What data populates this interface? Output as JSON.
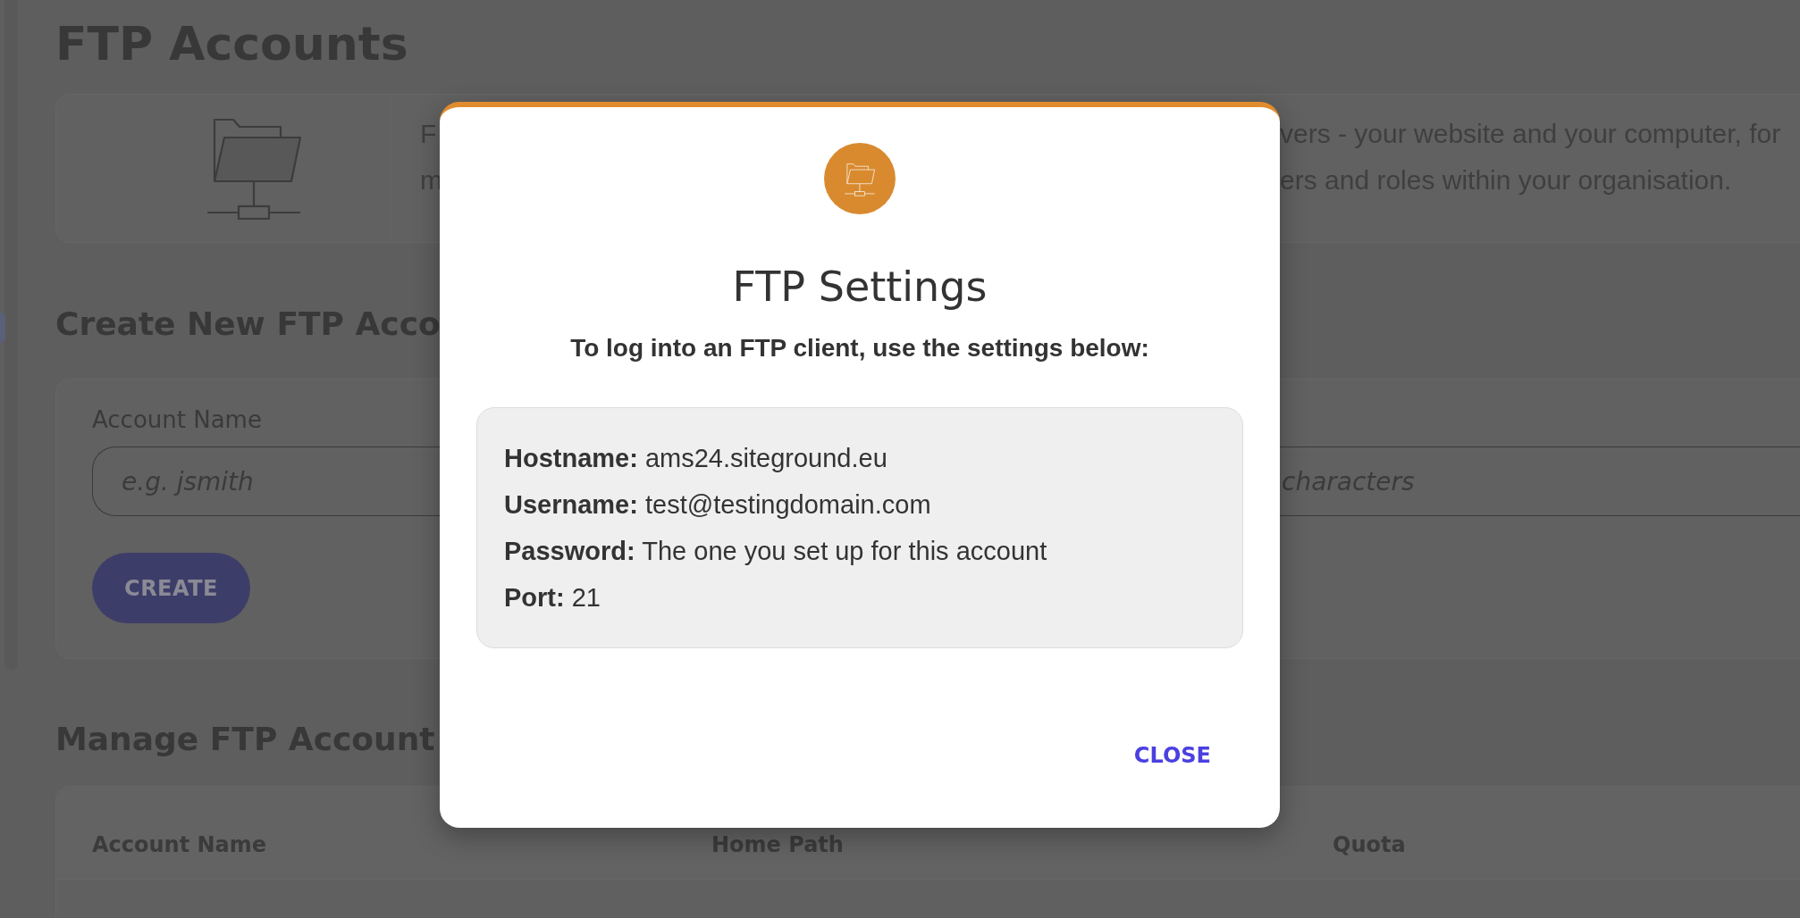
{
  "page": {
    "title": "FTP Accounts"
  },
  "info_card": {
    "lines": [
      {
        "start": "F",
        "end": "vers - your website and your computer, for"
      },
      {
        "start": "m",
        "end": "ers and roles within your organisation."
      }
    ]
  },
  "create_section": {
    "heading": "Create New FTP Acco",
    "fields": [
      {
        "label": "Account Name",
        "placeholder": "e.g. jsmith"
      },
      {
        "placeholder": "characters"
      }
    ],
    "button": "CREATE"
  },
  "manage_section": {
    "heading": "Manage FTP Account",
    "table": {
      "columns": [
        "Account Name",
        "Home Path",
        "Quota"
      ]
    }
  },
  "dialog": {
    "title": "FTP Settings",
    "subtitle": "To log into an FTP client, use the settings below:",
    "settings": [
      {
        "label": "Hostname:",
        "value": "ams24.siteground.eu"
      },
      {
        "label": "Username:",
        "value": "test@testingdomain.com"
      },
      {
        "label": "Password:",
        "value": "The one you set up for this account"
      },
      {
        "label": "Port:",
        "value": "21"
      }
    ],
    "buttons": [
      "CLOSE"
    ]
  }
}
